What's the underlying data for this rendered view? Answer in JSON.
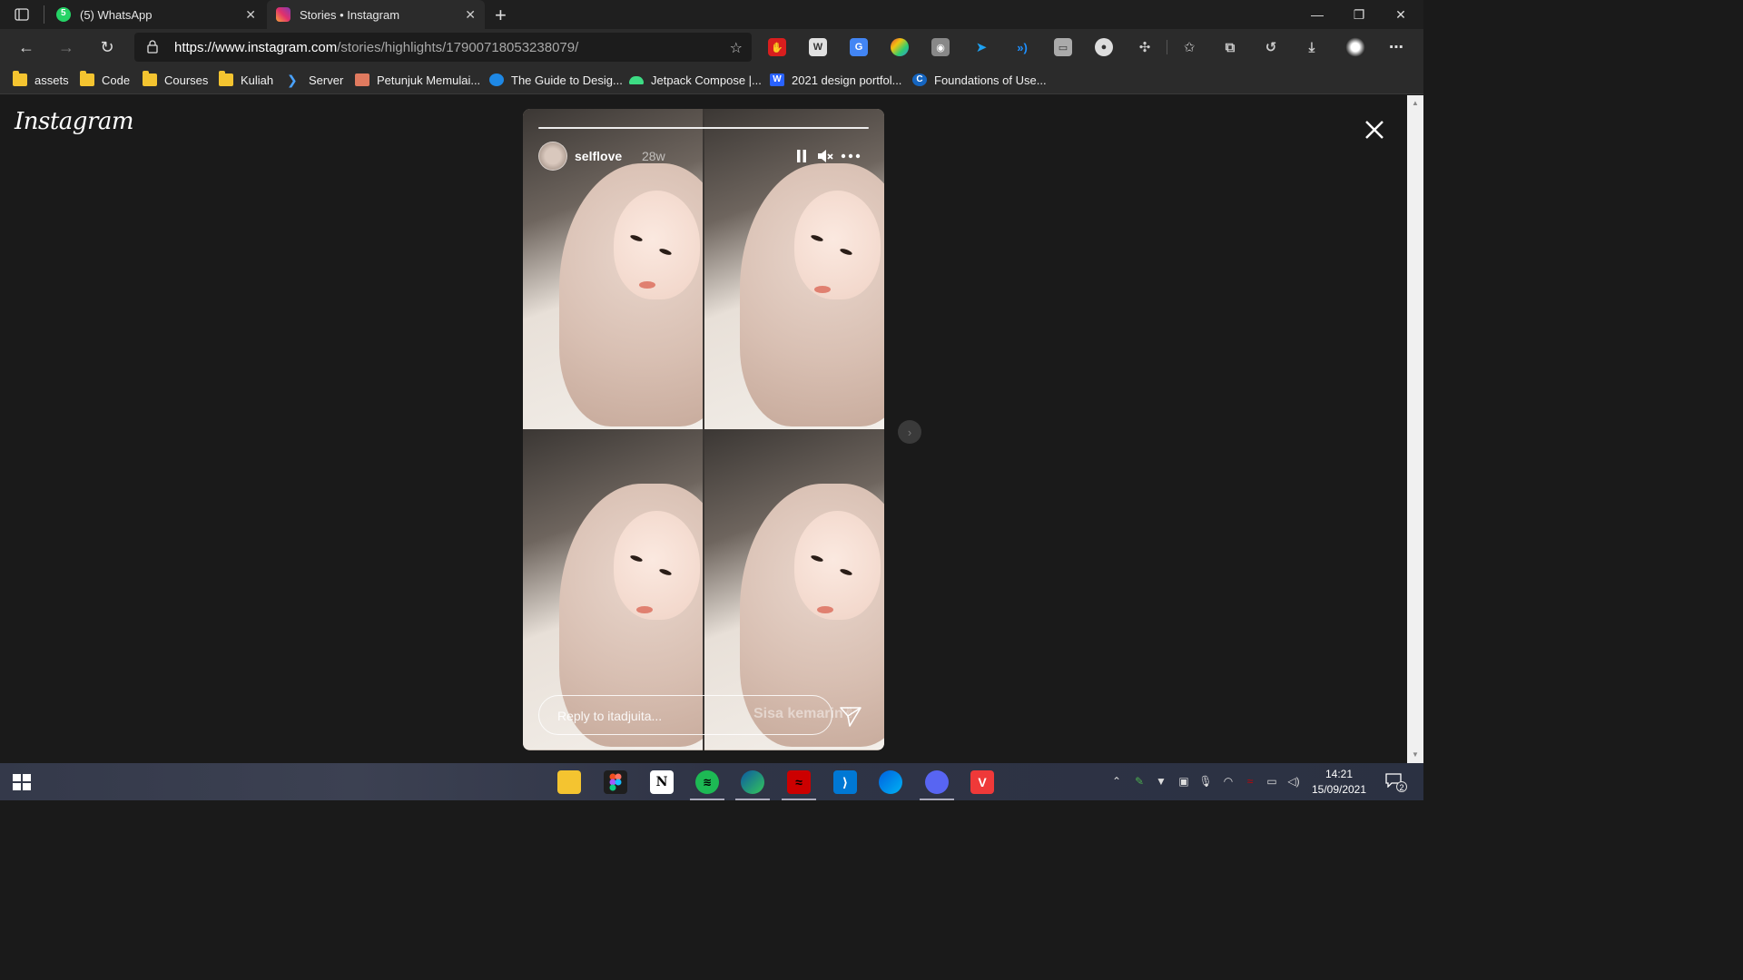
{
  "browser": {
    "tabs": [
      {
        "title": "(5) WhatsApp",
        "badge": "5",
        "active": false
      },
      {
        "title": "Stories • Instagram",
        "active": true
      }
    ],
    "url_main": "https://www.instagram.com",
    "url_path": "/stories/highlights/17900718053238079/",
    "bookmarks": [
      "assets",
      "Code",
      "Courses",
      "Kuliah",
      "Server",
      "Petunjuk Memulai...",
      "The Guide to Desig...",
      "Jetpack Compose |...",
      "2021 design portfol...",
      "Foundations of Use..."
    ],
    "extensions": [
      "adblock-icon",
      "word-icon",
      "translate-icon",
      "chrome-ext-icon",
      "camera-icon",
      "bird-icon",
      "wave-icon",
      "chat-icon",
      "circle-icon",
      "puzzle-icon"
    ],
    "colors": {
      "titlebar": "#1f1f1f",
      "toolbar": "#2b2b2b",
      "accent": "#f4c430"
    }
  },
  "instagram": {
    "logo": "Instagram",
    "story": {
      "username": "selflove",
      "age": "28w",
      "reply_placeholder": "Reply to itadjuita...",
      "caption_text": "Sisa kemarin✌"
    }
  },
  "taskbar": {
    "apps": [
      "file-explorer-icon",
      "figma-icon",
      "notion-icon",
      "spotify-icon",
      "edge-icon",
      "red-app-icon",
      "vscode-icon",
      "firefox-icon",
      "discord-icon",
      "vivaldi-icon"
    ],
    "time": "14:21",
    "date": "15/09/2021",
    "notification_count": "2"
  }
}
